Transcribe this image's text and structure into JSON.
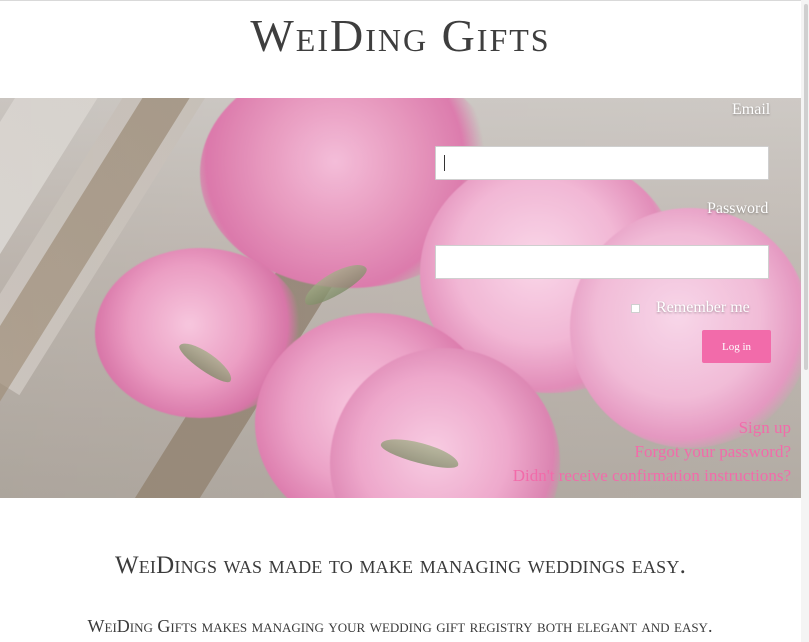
{
  "brand": {
    "title": "WeiDing Gifts"
  },
  "login": {
    "email_label": "Email",
    "email_value": "",
    "password_label": "Password",
    "password_value": "",
    "remember_label": "Remember me",
    "login_button": "Log in"
  },
  "links": [
    {
      "label": "Sign up"
    },
    {
      "label": "Forgot your password?"
    },
    {
      "label": "Didn't receive confirmation instructions?"
    }
  ],
  "content": {
    "headline": "WeiDings was made to make managing weddings easy.",
    "subline": "WeiDing Gifts makes managing your wedding gift registry both elegant and easy."
  },
  "colors": {
    "accent": "#f26baa",
    "text_dark": "#3b3b3b"
  }
}
